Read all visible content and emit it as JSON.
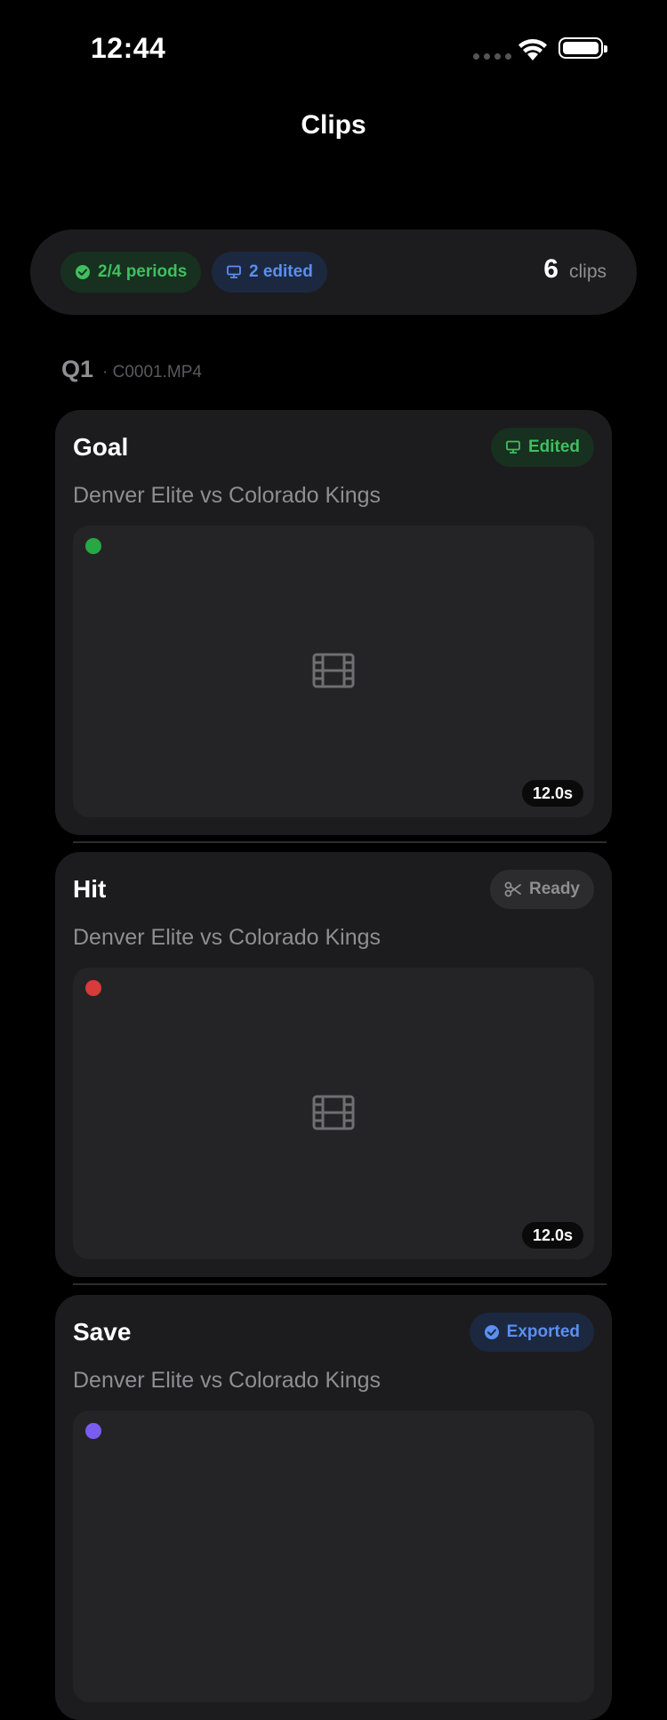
{
  "status_bar": {
    "time": "12:44"
  },
  "nav": {
    "title": "Clips"
  },
  "summary": {
    "periods_chip": "2/4 periods",
    "edited_chip": "2 edited",
    "clip_count": "6",
    "clip_count_label": "clips"
  },
  "section": {
    "period": "Q1",
    "file": "· C0001.MP4"
  },
  "clips": [
    {
      "title": "Goal",
      "subtitle": "Denver Elite vs Colorado Kings",
      "status": "Edited",
      "duration": "12.0s",
      "dot_color": "#28a745",
      "status_icon": "monitor-icon"
    },
    {
      "title": "Hit",
      "subtitle": "Denver Elite vs Colorado Kings",
      "status": "Ready",
      "duration": "12.0s",
      "dot_color": "#d93a3a",
      "status_icon": "scissors-icon"
    },
    {
      "title": "Save",
      "subtitle": "Denver Elite vs Colorado Kings",
      "status": "Exported",
      "duration": "",
      "dot_color": "#7a5cf0",
      "status_icon": "check-circle-icon"
    }
  ],
  "colors": {
    "green": "#3fbf5f",
    "blue": "#5b8ff0",
    "gray": "#8e8e93",
    "card": "#1c1c1e"
  }
}
